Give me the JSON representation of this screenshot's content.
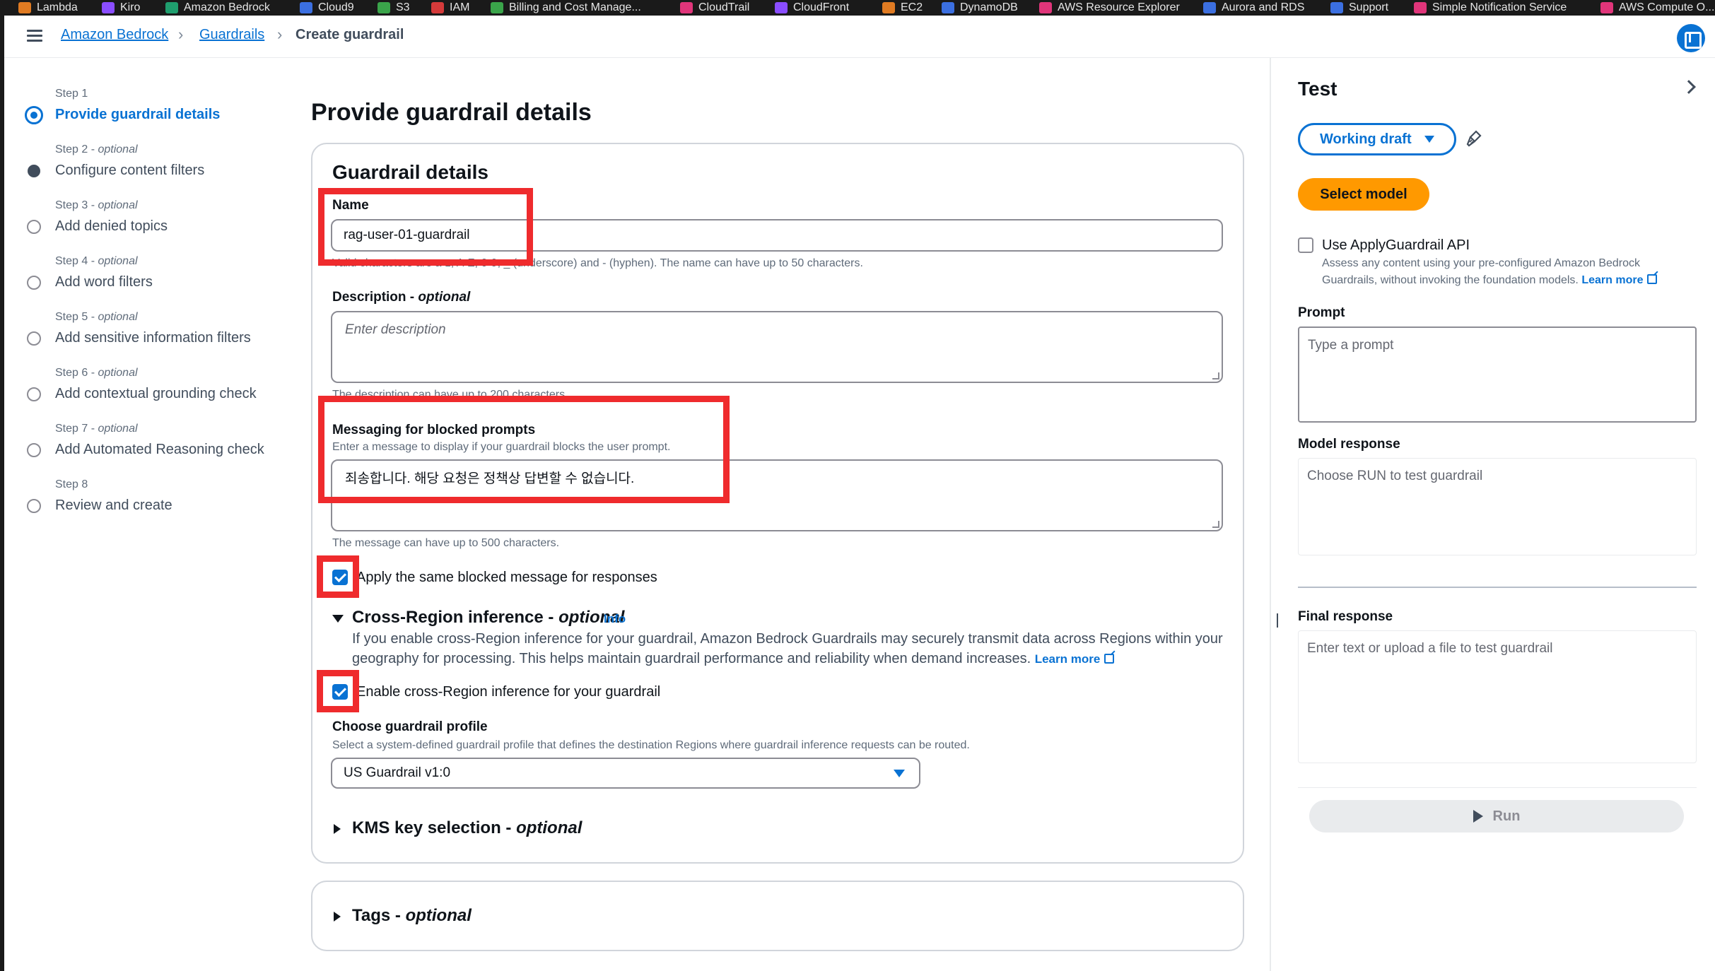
{
  "bookmarks": [
    {
      "label": "Lambda",
      "color": "#e07b22"
    },
    {
      "label": "Kiro",
      "color": "#8a4dff"
    },
    {
      "label": "Amazon Bedrock",
      "color": "#1f9e6e"
    },
    {
      "label": "CloudFront",
      "color": "#8a4dff"
    },
    {
      "label": "Cloud9",
      "color": "#3b6fe0"
    },
    {
      "label": "S3",
      "color": "#3aa44a"
    },
    {
      "label": "IAM",
      "color": "#d43a3a"
    },
    {
      "label": "Billing and Cost Manage...",
      "color": "#3aa44a"
    },
    {
      "label": "CloudTrail",
      "color": "#e0357a"
    },
    {
      "label": "CloudFront",
      "color": "#8a4dff"
    },
    {
      "label": "EC2",
      "color": "#e07b22"
    },
    {
      "label": "DynamoDB",
      "color": "#3b6fe0"
    },
    {
      "label": "AWS Resource Explorer",
      "color": "#e0357a"
    },
    {
      "label": "Aurora and RDS",
      "color": "#3b6fe0"
    },
    {
      "label": "Support",
      "color": "#3b6fe0"
    },
    {
      "label": "Simple Notification Service",
      "color": "#e0357a"
    },
    {
      "label": "AWS Compute O...",
      "color": "#e0357a"
    }
  ],
  "breadcrumb": {
    "items": [
      "Amazon Bedrock",
      "Guardrails"
    ],
    "current": "Create guardrail"
  },
  "steps": [
    {
      "num": "Step 1",
      "optional": "",
      "title": "Provide guardrail details",
      "state": "active"
    },
    {
      "num": "Step 2",
      "optional": "optional",
      "title": "Configure content filters",
      "state": "filled"
    },
    {
      "num": "Step 3",
      "optional": "optional",
      "title": "Add denied topics",
      "state": "empty"
    },
    {
      "num": "Step 4",
      "optional": "optional",
      "title": "Add word filters",
      "state": "empty"
    },
    {
      "num": "Step 5",
      "optional": "optional",
      "title": "Add sensitive information filters",
      "state": "empty"
    },
    {
      "num": "Step 6",
      "optional": "optional",
      "title": "Add contextual grounding check",
      "state": "empty"
    },
    {
      "num": "Step 7",
      "optional": "optional",
      "title": "Add Automated Reasoning check",
      "state": "empty"
    },
    {
      "num": "Step 8",
      "optional": "",
      "title": "Review and create",
      "state": "empty"
    }
  ],
  "main": {
    "page_title": "Provide guardrail details",
    "card_title": "Guardrail details",
    "name": {
      "label": "Name",
      "value": "rag-user-01-guardrail",
      "hint": "Valid characters are a-z, A-Z, 0-9, _ (underscore) and - (hyphen). The name can have up to 50 characters."
    },
    "description": {
      "label": "Description",
      "optional": "optional",
      "placeholder": "Enter description",
      "hint": "The description can have up to 200 characters."
    },
    "blocked": {
      "label": "Messaging for blocked prompts",
      "sub": "Enter a message to display if your guardrail blocks the user prompt.",
      "value": "죄송합니다. 해당 요청은 정책상 답변할 수 없습니다.",
      "hint": "The message can have up to 500 characters."
    },
    "same_message": {
      "label": "Apply the same blocked message for responses",
      "checked": true
    },
    "cross_region": {
      "title": "Cross-Region inference",
      "optional": "optional",
      "info": "Info",
      "desc1": "If you enable cross-Region inference for your guardrail, Amazon Bedrock Guardrails may securely transmit data across Regions within your",
      "desc2": "geography for processing. This helps maintain guardrail performance and reliability when demand increases.",
      "learn_more": "Learn more",
      "enable_label": "Enable cross-Region inference for your guardrail",
      "enabled": true
    },
    "profile": {
      "label": "Choose guardrail profile",
      "hint": "Select a system-defined guardrail profile that defines the destination Regions where guardrail inference requests can be routed.",
      "value": "US Guardrail v1:0"
    },
    "kms": {
      "title": "KMS key selection",
      "optional": "optional"
    },
    "tags": {
      "title": "Tags",
      "optional": "optional"
    }
  },
  "test_panel": {
    "title": "Test",
    "version": "Working draft",
    "select_model": "Select model",
    "apply_api": {
      "label": "Use ApplyGuardrail API",
      "desc1": "Assess any content using your pre-configured Amazon Bedrock",
      "desc2": "Guardrails, without invoking the foundation models.",
      "learn_more": "Learn more"
    },
    "prompt_label": "Prompt",
    "prompt_placeholder": "Type a prompt",
    "model_response_label": "Model response",
    "model_response_placeholder": "Choose RUN to test guardrail",
    "final_response_label": "Final response",
    "final_response_placeholder": "Enter text or upload a file to test guardrail",
    "run": "Run"
  },
  "colors": {
    "accent": "#0972d3",
    "orange": "#ff9900",
    "highlight": "#ef2b2d"
  }
}
